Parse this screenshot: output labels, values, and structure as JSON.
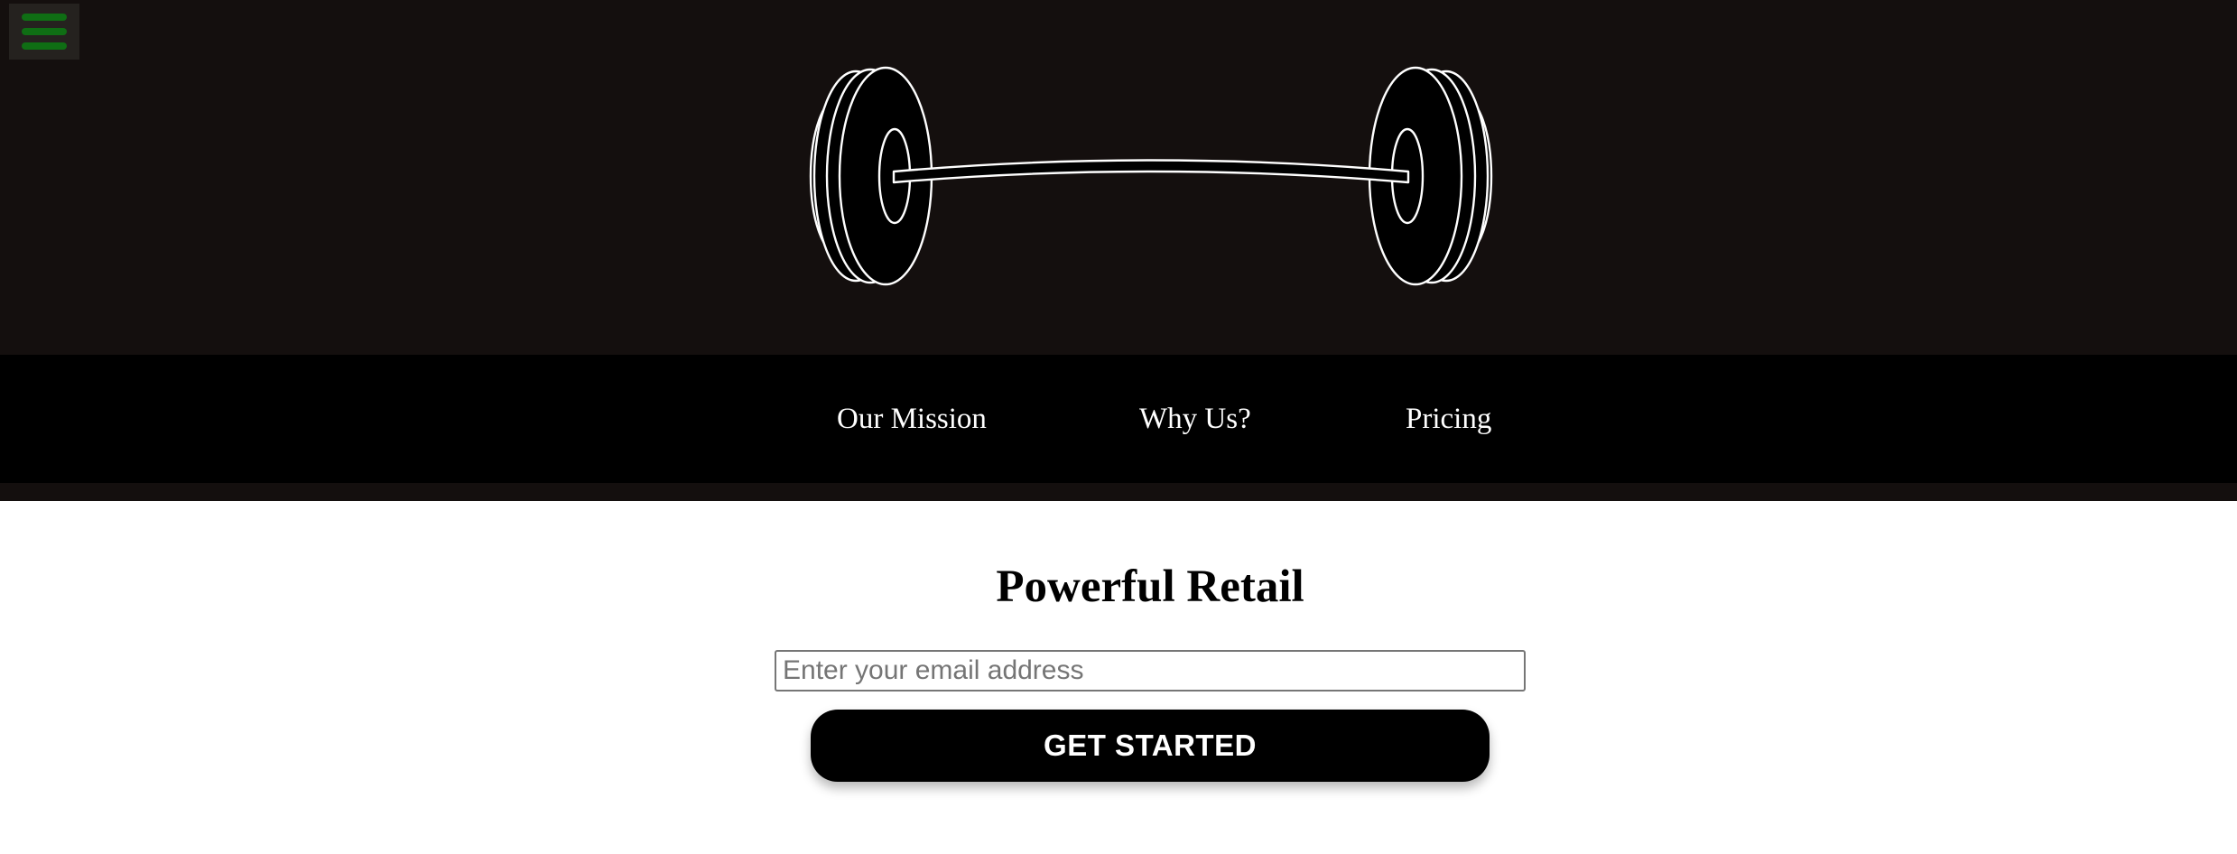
{
  "header": {
    "menu_icon": "hamburger-menu-icon",
    "logo_icon": "barbell-icon",
    "background_color": "#140f0e",
    "menu_bar_color": "#0f6e14"
  },
  "nav": {
    "items": [
      {
        "label": "Our Mission"
      },
      {
        "label": "Why Us?"
      },
      {
        "label": "Pricing"
      }
    ]
  },
  "hero": {
    "title": "Powerful Retail",
    "email_placeholder": "Enter your email address",
    "email_value": "",
    "cta_label": "GET STARTED"
  }
}
